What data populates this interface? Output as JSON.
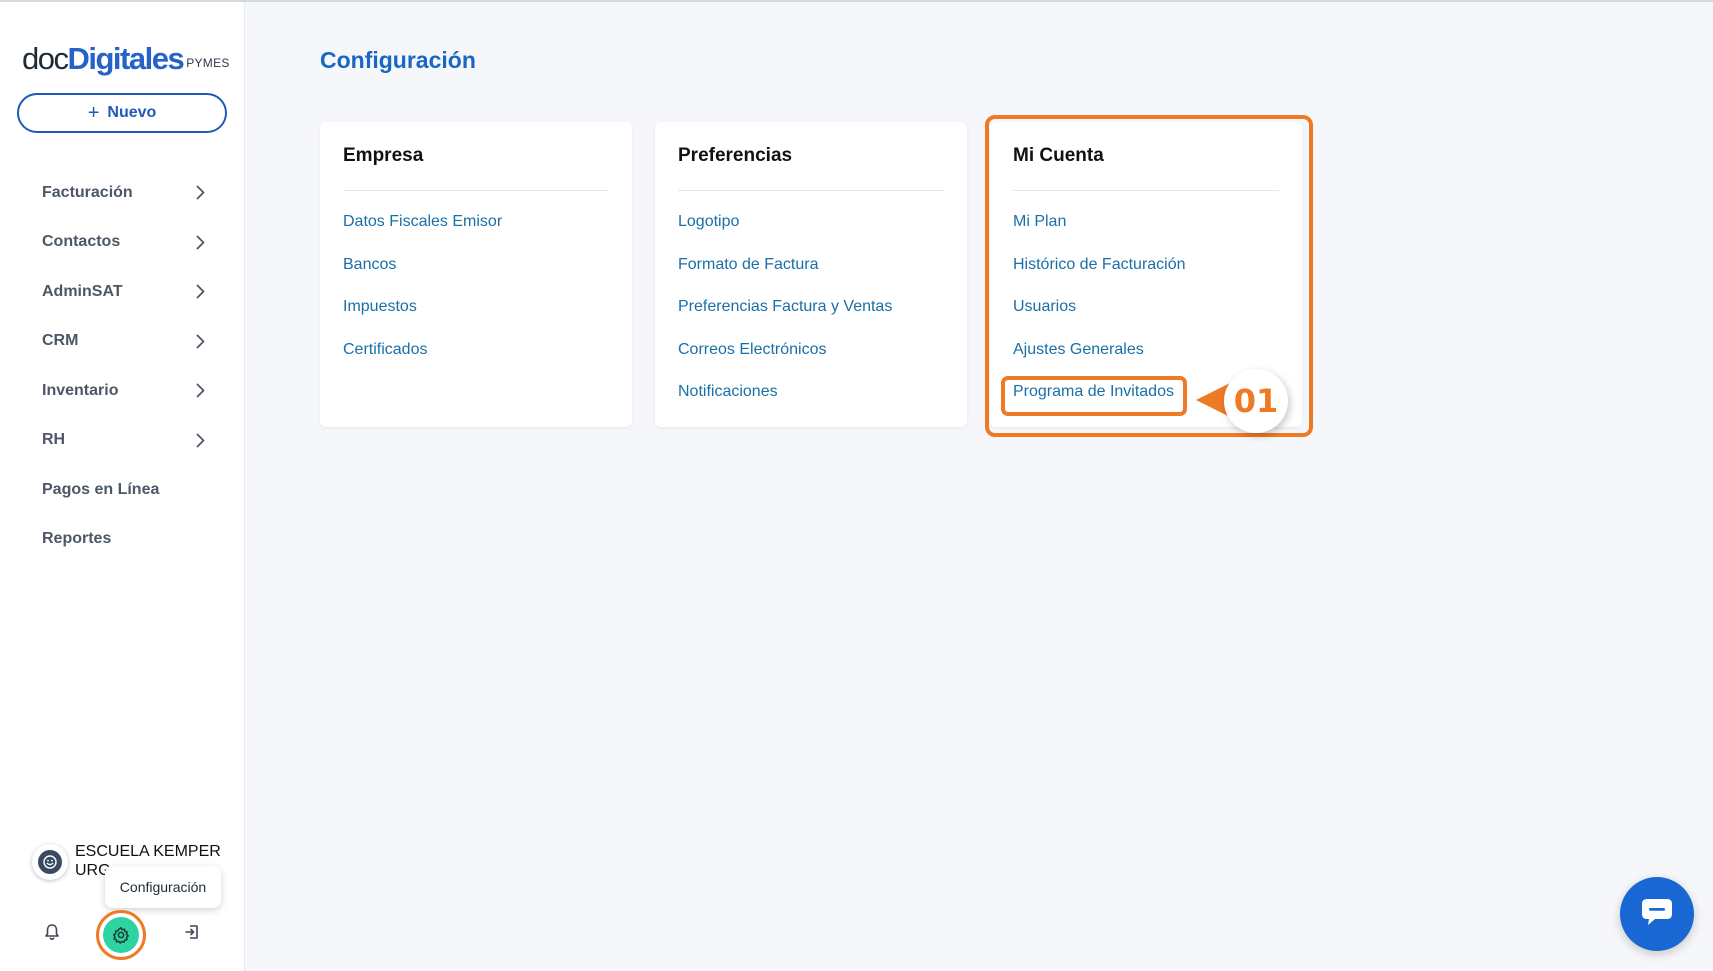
{
  "sidebar": {
    "logo": {
      "part1": "doc",
      "part2": "Digitales",
      "part3": "PYMES"
    },
    "new_button": {
      "icon": "plus-icon",
      "label": "Nuevo"
    },
    "items": [
      {
        "label": "Facturación",
        "has_chevron": true
      },
      {
        "label": "Contactos",
        "has_chevron": true
      },
      {
        "label": "AdminSAT",
        "has_chevron": true
      },
      {
        "label": "CRM",
        "has_chevron": true
      },
      {
        "label": "Inventario",
        "has_chevron": true
      },
      {
        "label": "RH",
        "has_chevron": true
      },
      {
        "label": "Pagos en Línea",
        "has_chevron": false
      },
      {
        "label": "Reportes",
        "has_chevron": false
      }
    ],
    "account": {
      "name": "ESCUELA KEMPER URG"
    },
    "tooltip": "Configuración",
    "bottom_icons": [
      "bell-icon",
      "gear-icon",
      "logout-icon"
    ]
  },
  "main": {
    "title": "Configuración",
    "cards": [
      {
        "title": "Empresa",
        "links": [
          "Datos Fiscales Emisor",
          "Bancos",
          "Impuestos",
          "Certificados"
        ]
      },
      {
        "title": "Preferencias",
        "links": [
          "Logotipo",
          "Formato de Factura",
          "Preferencias Factura y Ventas",
          "Correos Electrónicos",
          "Notificaciones"
        ]
      },
      {
        "title": "Mi Cuenta",
        "links": [
          "Mi Plan",
          "Histórico de Facturación",
          "Usuarios",
          "Ajustes Generales",
          "Programa de Invitados"
        ]
      }
    ]
  },
  "annotation": {
    "step": "01",
    "color": "#ef7a25"
  },
  "chat": {
    "icon": "chat-bubble-icon",
    "color": "#1967d2"
  },
  "colors": {
    "brand_blue": "#1967c0",
    "link": "#1a6fa8",
    "accent_green": "#2ed3a2"
  }
}
